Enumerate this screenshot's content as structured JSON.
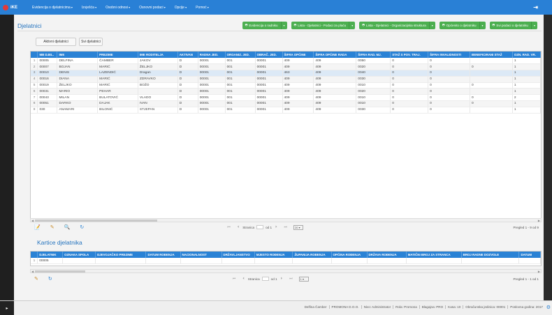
{
  "app": {
    "logo_text": "iKE",
    "menu": [
      "Evidencija o djelatnicima",
      "Izvješća",
      "Osobni odnosi",
      "Osnovni podaci",
      "Opcije",
      "Pomoć"
    ]
  },
  "page_title": "Djelatnici",
  "buttons": [
    "Evidencija o radniku",
    "Lista - Djelatnici - Podaci za plaću",
    "Lista - Djelatnici - Organizacijska struktura",
    "Općenito o djelatniku",
    "Svi podaci o djelatniku"
  ],
  "filters": {
    "active": "Aktivni djelatnici",
    "all": "Svi djelatnici"
  },
  "employees": {
    "columns": [
      "MB DJEL.",
      "IME",
      "PREZIME",
      "IME RODITELJA",
      "AKTIVAN",
      "RADNA JED.",
      "ORGANIZ. JED.",
      "OBRAČ. JED.",
      "ŠIFRA OPĆINE",
      "ŠIFRA OPĆINE RADA",
      "ŠIFRA RAD. MJ.",
      "STAŽ S POV. TRAJ.",
      "ŠIFRA INVALIDNOSTI",
      "BENEFICIRANI STAŽ",
      "OZN. RAD. VR."
    ],
    "rows": [
      [
        "1",
        "00005",
        "DELFINA",
        "ČAMBER",
        "JAKOV",
        "D",
        "00001",
        "001",
        "00001",
        "409",
        "409",
        "0050",
        "0",
        "0",
        "",
        "1"
      ],
      [
        "2",
        "00007",
        "BOJAN",
        "MARIĆ",
        "ŽELJKO",
        "D",
        "00001",
        "001",
        "00001",
        "409",
        "409",
        "0020",
        "0",
        "0",
        "0",
        "1"
      ],
      [
        "3",
        "00010",
        "DENIS",
        "LAZENDIĆ",
        "Dragan",
        "D",
        "00001",
        "001",
        "00001",
        "463",
        "409",
        "0040",
        "0",
        "0",
        "",
        "1"
      ],
      [
        "4",
        "00016",
        "DIANA",
        "MARIĆ",
        "ZDRAVKO",
        "D",
        "00001",
        "001",
        "00001",
        "409",
        "409",
        "0030",
        "0",
        "0",
        "",
        "1"
      ],
      [
        "5",
        "00019",
        "ŽELJKO",
        "MARIĆ",
        "BOŽO",
        "D",
        "00001",
        "001",
        "00001",
        "409",
        "409",
        "0010",
        "0",
        "0",
        "0",
        "1"
      ],
      [
        "6",
        "00031",
        "MARIO",
        "PEHAR",
        "",
        "D",
        "00001",
        "001",
        "00001",
        "409",
        "409",
        "0020",
        "0",
        "0",
        "",
        "1"
      ],
      [
        "7",
        "00043",
        "MILAN",
        "BULATOVIĆ",
        "VLADO",
        "D",
        "00001",
        "001",
        "00001",
        "409",
        "409",
        "0010",
        "0",
        "0",
        "0",
        "2"
      ],
      [
        "8",
        "00051",
        "DARKO",
        "DAJAK",
        "IVAN",
        "D",
        "00001",
        "001",
        "00001",
        "409",
        "409",
        "0010",
        "0",
        "0",
        "0",
        "1"
      ],
      [
        "9",
        "030",
        "ANAMARI",
        "BILONIĆ",
        "STJEPAN",
        "D",
        "00001",
        "001",
        "00001",
        "409",
        "409",
        "0030",
        "0",
        "0",
        "",
        "1"
      ]
    ],
    "pager": {
      "page_label": "Stranica",
      "page_value": "1",
      "of_label": "od 1",
      "page_size": "20",
      "summary": "Pregled 1 - 9 od 9"
    }
  },
  "cards": {
    "title": "Kartice djelatnika",
    "columns": [
      "DJELATNIK",
      "OZNAKA SPOLA",
      "DJEVOJAČKO PREZIME",
      "DATUM ROĐENJA",
      "NACIONALNOST",
      "DRŽAVLJANSTVO",
      "MJESTO ROĐENJA",
      "ŽUPANIJA ROĐENJA",
      "OPĆINA ROĐENJA",
      "DRŽAVA ROĐENJA",
      "MATIČNI BROJ ZA STRANCA",
      "BROJ RADNE DOZVOLE",
      "DATUM"
    ],
    "rows": [
      [
        "1",
        "00005",
        "",
        "",
        "",
        "",
        "",
        "",
        "",
        "",
        "",
        "",
        "",
        ""
      ]
    ],
    "pager": {
      "page_label": "Stranica",
      "page_value": "1",
      "of_label": "od 1",
      "page_size": "1",
      "summary": "Pregled 1 - 1 od 1"
    }
  },
  "status": [
    "Delfina Čamber",
    "PROMONA D.O.O.",
    "Nivo: Administrator",
    "Rola: Promona",
    "Blagajna: PRO",
    "Kasa: 10",
    "Obračunska jedinica: 00001",
    "Poslovna godina: 2017"
  ]
}
